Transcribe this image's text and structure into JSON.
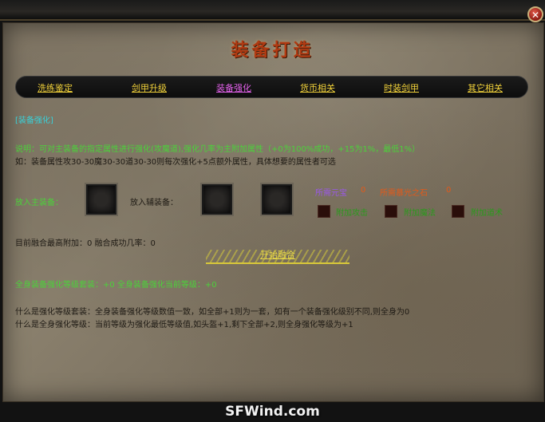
{
  "window": {
    "title": "装备打造",
    "close_glyph": "✕"
  },
  "tabs": [
    {
      "label": "洗练鉴定",
      "active": false
    },
    {
      "label": "剑甲升级",
      "active": false
    },
    {
      "label": "装备强化",
      "active": true
    },
    {
      "label": "货币相关",
      "active": false
    },
    {
      "label": "时装剑甲",
      "active": false
    },
    {
      "label": "其它相关",
      "active": false
    }
  ],
  "section": {
    "header": "[装备强化]",
    "desc_line1": "说明：可对主装备的指定属性进行强化(攻魔道),强化几率为主附加属性（+0为100%成功，+15为1%，最低1%）",
    "desc_line2": "如：装备属性攻30-30魔30-30道30-30则每次强化+5点额外属性，具体想要的属性者可选"
  },
  "slots": {
    "main_label": "放入主装备：",
    "aux_label": "放入辅装备："
  },
  "costs": {
    "yuanbao_label": "所需元宝",
    "yuanbao_value": "0",
    "stone_label": "所需慕光之石",
    "stone_value": "0"
  },
  "options": [
    {
      "label": "附加攻击"
    },
    {
      "label": "附加魔法"
    },
    {
      "label": "附加道术"
    }
  ],
  "fusion": {
    "status": "目前融合最高附加：0 融合成功几率：0",
    "button_label": "开始融合"
  },
  "suit": {
    "line": "全身装备强化等级套装：+0   全身装备强化当前等级：+0"
  },
  "help": {
    "line1": "什么是强化等级套装：全身装备强化等级数值一致，如全部+1则为一套，如有一个装备强化级别不同,则全身为0",
    "line2": "什么是全身强化等级：当前等级为强化最低等级值,如头盔+1,剩下全部+2,则全身强化等级为+1"
  },
  "watermark": "SFWind.com",
  "colors": {
    "title": "#b03a12",
    "tab": "#f2d23a",
    "tab_active": "#e060e8",
    "header": "#39d0d8",
    "desc": "#4bd23a",
    "cost_yuanbao": "#9a58e8",
    "cost_stone": "#e25a1a"
  }
}
